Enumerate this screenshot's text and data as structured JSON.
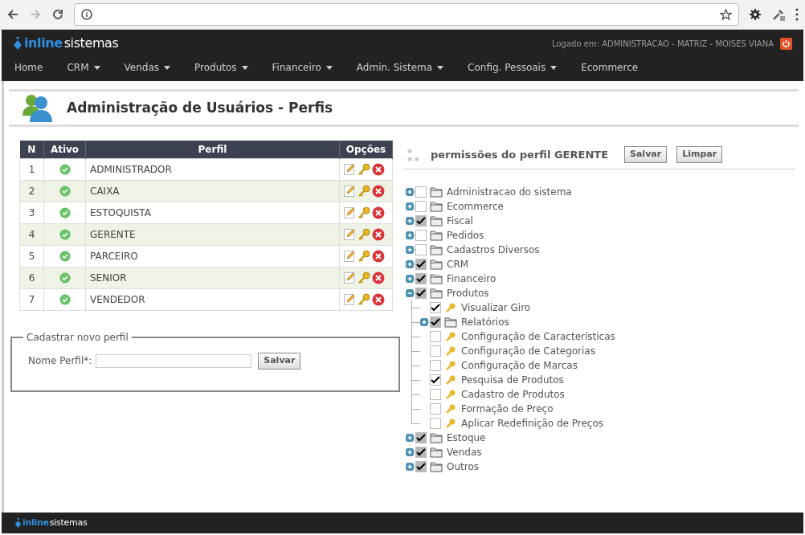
{
  "header": {
    "logo_primary": "inline",
    "logo_secondary": "sistemas",
    "logged_in": "Logado em: ADMINISTRACAO - MATRIZ - MOISES VIANA"
  },
  "footer": {
    "logo_primary": "inline",
    "logo_secondary": "sistemas"
  },
  "menu": [
    {
      "label": "Home",
      "dropdown": false
    },
    {
      "label": "CRM",
      "dropdown": true
    },
    {
      "label": "Vendas",
      "dropdown": true
    },
    {
      "label": "Produtos",
      "dropdown": true
    },
    {
      "label": "Financeiro",
      "dropdown": true
    },
    {
      "label": "Admin. Sistema",
      "dropdown": true
    },
    {
      "label": "Config. Pessoais",
      "dropdown": true
    },
    {
      "label": "Ecommerce",
      "dropdown": false
    }
  ],
  "page_title": "Administração de Usuários - Perfis",
  "table": {
    "columns": [
      "N",
      "Ativo",
      "Perfil",
      "Opções"
    ],
    "rows": [
      {
        "n": "1",
        "active": true,
        "perfil": "ADMINISTRADOR"
      },
      {
        "n": "2",
        "active": true,
        "perfil": "CAIXA"
      },
      {
        "n": "3",
        "active": true,
        "perfil": "ESTOQUISTA"
      },
      {
        "n": "4",
        "active": true,
        "perfil": "GERENTE"
      },
      {
        "n": "5",
        "active": true,
        "perfil": "PARCEIRO"
      },
      {
        "n": "6",
        "active": true,
        "perfil": "SENIOR"
      },
      {
        "n": "7",
        "active": true,
        "perfil": "VENDEDOR"
      }
    ]
  },
  "new_profile": {
    "legend": "Cadastrar novo perfil",
    "label": "Nome Perfil*:",
    "button": "Salvar"
  },
  "permissions": {
    "title": "permissões do perfil GERENTE",
    "buttons": [
      "Salvar",
      "Limpar"
    ],
    "tree": [
      {
        "label": "Administracao do sistema",
        "kind": "group",
        "checked": false,
        "expanded": false
      },
      {
        "label": "Ecommerce",
        "kind": "group",
        "checked": false,
        "expanded": false
      },
      {
        "label": "Fiscal",
        "kind": "group",
        "checked": true,
        "expanded": false
      },
      {
        "label": "Pedidos",
        "kind": "group",
        "checked": false,
        "expanded": false
      },
      {
        "label": "Cadastros Diversos",
        "kind": "group",
        "checked": false,
        "expanded": false
      },
      {
        "label": "CRM",
        "kind": "group",
        "checked": true,
        "expanded": false
      },
      {
        "label": "Financeiro",
        "kind": "group",
        "checked": true,
        "expanded": false
      },
      {
        "label": "Produtos",
        "kind": "group",
        "checked": true,
        "expanded": true,
        "children": [
          {
            "label": "Visualizar Giro",
            "kind": "permission",
            "checked": true
          },
          {
            "label": "Relatórios",
            "kind": "group",
            "checked": true,
            "expanded": false
          },
          {
            "label": "Configuração de Características",
            "kind": "permission",
            "checked": false
          },
          {
            "label": "Configuração de Categorias",
            "kind": "permission",
            "checked": false
          },
          {
            "label": "Configuração de Marcas",
            "kind": "permission",
            "checked": false
          },
          {
            "label": "Pesquisa de Produtos",
            "kind": "permission",
            "checked": true
          },
          {
            "label": "Cadastro de Produtos",
            "kind": "permission",
            "checked": false
          },
          {
            "label": "Formação de Preço",
            "kind": "permission",
            "checked": false
          },
          {
            "label": "Aplicar Redefinição de Preços",
            "kind": "permission",
            "checked": false
          }
        ]
      },
      {
        "label": "Estoque",
        "kind": "group",
        "checked": true,
        "expanded": false
      },
      {
        "label": "Vendas",
        "kind": "group",
        "checked": true,
        "expanded": false
      },
      {
        "label": "Outros",
        "kind": "group",
        "checked": true,
        "expanded": false
      }
    ]
  }
}
